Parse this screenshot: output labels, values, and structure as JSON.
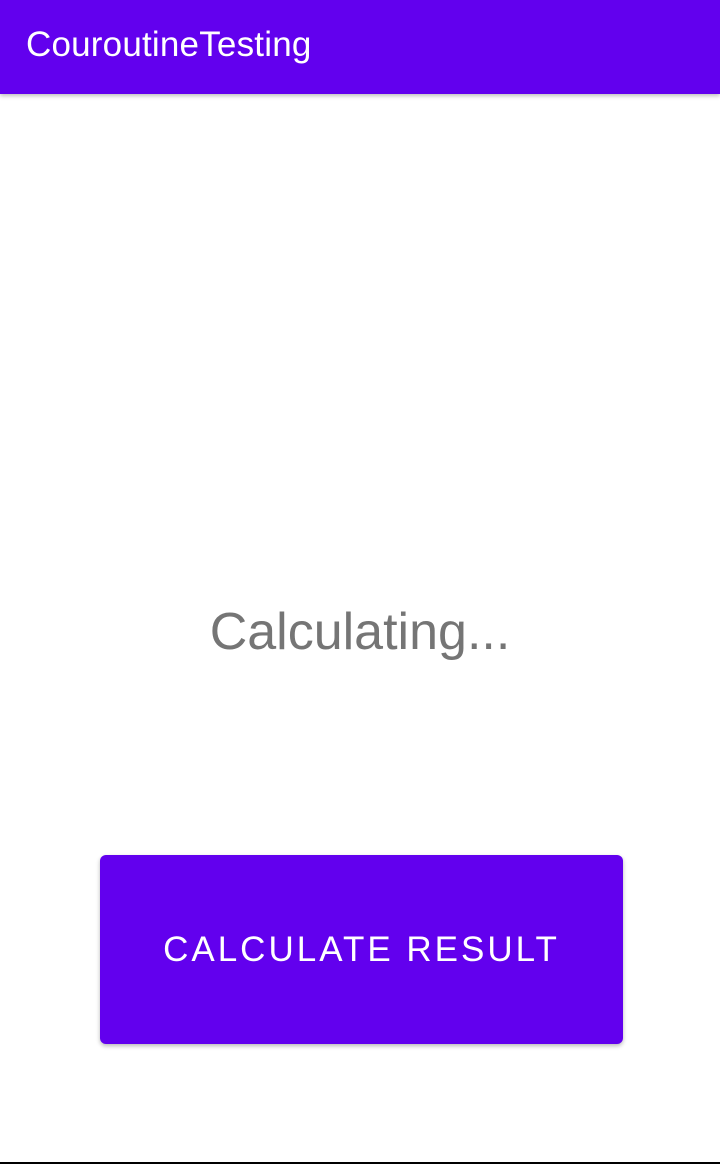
{
  "app_bar": {
    "title": "CouroutineTesting",
    "color": "#6200ee"
  },
  "main": {
    "status_text": "Calculating...",
    "status_color": "#757575"
  },
  "button": {
    "label": "CALCULATE RESULT",
    "color": "#6200ee"
  }
}
